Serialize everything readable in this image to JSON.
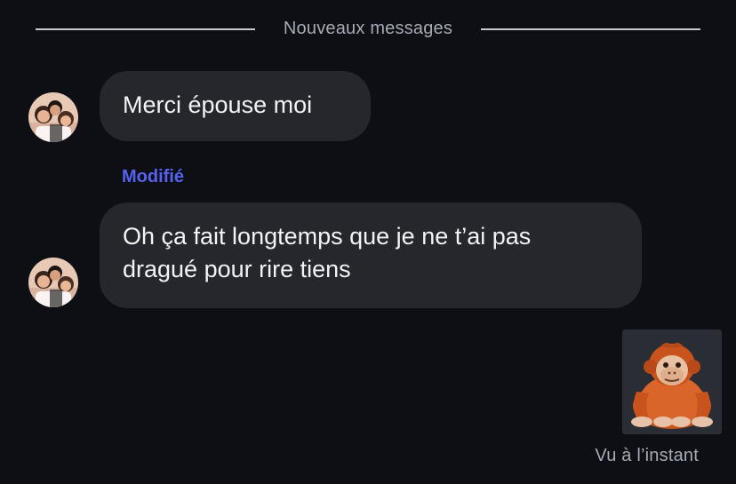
{
  "divider": {
    "label": "Nouveaux messages"
  },
  "messages": [
    {
      "text": "Merci épouse moi",
      "avatar_icon": "contact-avatar-photo"
    },
    {
      "edited_label": "Modifié",
      "line1": "Oh ça fait longtemps que je ne t’ai pas",
      "line2": "dragué pour rire tiens",
      "avatar_icon": "contact-avatar-photo"
    }
  ],
  "reaction": {
    "sticker_icon": "orangutan-emoji"
  },
  "receipt": {
    "text": "Vu à l’instant"
  },
  "colors": {
    "background": "#0d0f14",
    "bubble": "#25272c",
    "edited": "#5661f0",
    "muted_text": "#a6abb3"
  }
}
